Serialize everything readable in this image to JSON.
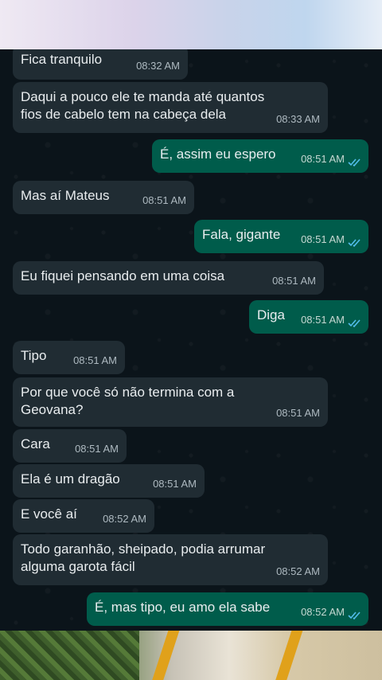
{
  "messages": [
    {
      "dir": "in",
      "text": "Fica tranquilo",
      "time": "08:32 AM"
    },
    {
      "dir": "in",
      "text": "Daqui a pouco ele te manda até quantos\nfios de cabelo tem na cabeça dela",
      "time": "08:33 AM"
    },
    {
      "dir": "out",
      "text": "É, assim eu espero",
      "time": "08:51 AM"
    },
    {
      "dir": "in",
      "text": "Mas aí Mateus",
      "time": "08:51 AM"
    },
    {
      "dir": "out",
      "text": "Fala, gigante",
      "time": "08:51 AM"
    },
    {
      "dir": "in",
      "text": "Eu fiquei pensando em uma coisa",
      "time": "08:51 AM"
    },
    {
      "dir": "out",
      "text": "Diga",
      "time": "08:51 AM"
    },
    {
      "dir": "in",
      "text": "Tipo",
      "time": "08:51 AM"
    },
    {
      "dir": "in",
      "text": "Por que você só não termina com a\nGeovana?",
      "time": "08:51 AM"
    },
    {
      "dir": "in",
      "text": "Cara",
      "time": "08:51 AM"
    },
    {
      "dir": "in",
      "text": "Ela é um dragão",
      "time": "08:51 AM"
    },
    {
      "dir": "in",
      "text": "E você aí",
      "time": "08:52 AM"
    },
    {
      "dir": "in",
      "text": "Todo garanhão, sheipado, podia arrumar\nalguma garota fácil",
      "time": "08:52 AM"
    },
    {
      "dir": "out",
      "text": "É, mas tipo, eu amo ela sabe",
      "time": "08:52 AM"
    }
  ],
  "colors": {
    "chat_background": "#0b141a",
    "incoming_bubble": "#202c33",
    "outgoing_bubble": "#005c4b",
    "read_ticks": "#53bdeb"
  },
  "icons": {
    "read_receipt": "double-check-icon"
  }
}
